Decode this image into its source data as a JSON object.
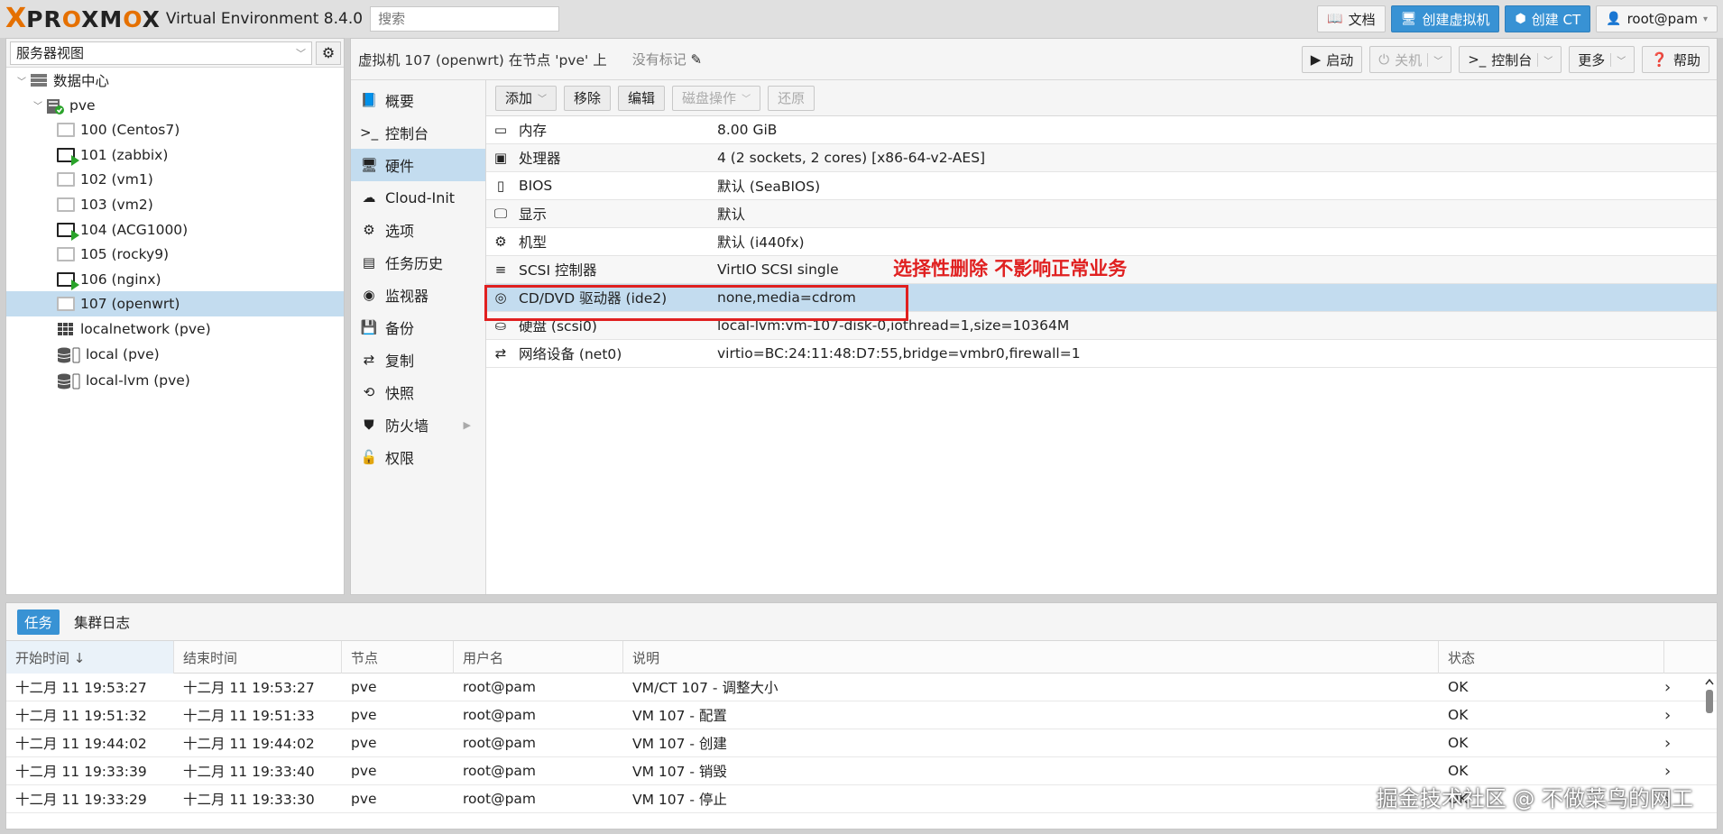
{
  "topbar": {
    "logo_x": "X",
    "logo_brand": "PROXMOX",
    "version": "Virtual Environment 8.4.0",
    "search_placeholder": "搜索",
    "buttons": {
      "docs": "文档",
      "create_vm": "创建虚拟机",
      "create_ct": "创建 CT",
      "user": "root@pam"
    }
  },
  "left": {
    "view": "服务器视图",
    "tree": [
      {
        "label": "数据中心",
        "type": "datacenter"
      },
      {
        "label": "pve",
        "type": "node"
      },
      {
        "label": "100 (Centos7)",
        "type": "vm",
        "running": false
      },
      {
        "label": "101 (zabbix)",
        "type": "vm",
        "running": true
      },
      {
        "label": "102 (vm1)",
        "type": "vm",
        "running": false
      },
      {
        "label": "103 (vm2)",
        "type": "vm",
        "running": false
      },
      {
        "label": "104 (ACG1000)",
        "type": "vm",
        "running": true
      },
      {
        "label": "105 (rocky9)",
        "type": "vm",
        "running": false
      },
      {
        "label": "106 (nginx)",
        "type": "vm",
        "running": true
      },
      {
        "label": "107 (openwrt)",
        "type": "vm",
        "running": false,
        "selected": true
      },
      {
        "label": "localnetwork (pve)",
        "type": "network"
      },
      {
        "label": "local (pve)",
        "type": "storage"
      },
      {
        "label": "local-lvm (pve)",
        "type": "storage"
      }
    ]
  },
  "main": {
    "title": "虚拟机 107 (openwrt) 在节点 'pve' 上",
    "tags": "没有标记",
    "buttons": {
      "start": "启动",
      "shutdown": "关机",
      "console": "控制台",
      "more": "更多",
      "help": "帮助"
    },
    "nav": [
      {
        "label": "概要",
        "icon": "summary-icon"
      },
      {
        "label": "控制台",
        "icon": "terminal-icon"
      },
      {
        "label": "硬件",
        "icon": "monitor-icon",
        "active": true
      },
      {
        "label": "Cloud-Init",
        "icon": "cloud-icon"
      },
      {
        "label": "选项",
        "icon": "gear-icon"
      },
      {
        "label": "任务历史",
        "icon": "list-icon"
      },
      {
        "label": "监视器",
        "icon": "eye-icon"
      },
      {
        "label": "备份",
        "icon": "floppy-icon"
      },
      {
        "label": "复制",
        "icon": "retweet-icon"
      },
      {
        "label": "快照",
        "icon": "history-icon"
      },
      {
        "label": "防火墙",
        "icon": "shield-icon"
      },
      {
        "label": "权限",
        "icon": "unlock-icon"
      }
    ],
    "hw_toolbar": {
      "add": "添加",
      "remove": "移除",
      "edit": "编辑",
      "disk_action": "磁盘操作",
      "revert": "还原"
    },
    "hardware": [
      {
        "name": "内存",
        "value": "8.00 GiB",
        "icon": "memory-icon"
      },
      {
        "name": "处理器",
        "value": "4 (2 sockets, 2 cores) [x86-64-v2-AES]",
        "icon": "cpu-icon"
      },
      {
        "name": "BIOS",
        "value": "默认 (SeaBIOS)",
        "icon": "microchip-icon"
      },
      {
        "name": "显示",
        "value": "默认",
        "icon": "desktop-icon"
      },
      {
        "name": "机型",
        "value": "默认 (i440fx)",
        "icon": "cogs-icon"
      },
      {
        "name": "SCSI 控制器",
        "value": "VirtIO SCSI single",
        "icon": "database-icon"
      },
      {
        "name": "CD/DVD 驱动器 (ide2)",
        "value": "none,media=cdrom",
        "icon": "cdrom-icon",
        "selected": true
      },
      {
        "name": "硬盘 (scsi0)",
        "value": "local-lvm:vm-107-disk-0,iothread=1,size=10364M",
        "icon": "hdd-icon"
      },
      {
        "name": "网络设备 (net0)",
        "value": "virtio=BC:24:11:48:D7:55,bridge=vmbr0,firewall=1",
        "icon": "exchange-icon"
      }
    ],
    "annotation": "选择性删除 不影响正常业务",
    "annotation_color": "#e02020"
  },
  "bottom": {
    "tabs": [
      "任务",
      "集群日志"
    ],
    "columns": [
      "开始时间 ↓",
      "结束时间",
      "节点",
      "用户名",
      "说明",
      "状态"
    ],
    "rows": [
      [
        "十二月 11 19:53:27",
        "十二月 11 19:53:27",
        "pve",
        "root@pam",
        "VM/CT 107 - 调整大小",
        "OK"
      ],
      [
        "十二月 11 19:51:32",
        "十二月 11 19:51:33",
        "pve",
        "root@pam",
        "VM 107 - 配置",
        "OK"
      ],
      [
        "十二月 11 19:44:02",
        "十二月 11 19:44:02",
        "pve",
        "root@pam",
        "VM 107 - 创建",
        "OK"
      ],
      [
        "十二月 11 19:33:39",
        "十二月 11 19:33:40",
        "pve",
        "root@pam",
        "VM 107 - 销毁",
        "OK"
      ],
      [
        "十二月 11 19:33:29",
        "十二月 11 19:33:30",
        "pve",
        "root@pam",
        "VM 107 - 停止",
        "OK"
      ]
    ]
  },
  "watermark": "掘金技术社区 @ 不做菜鸟的网工",
  "colors": {
    "accent": "#3892d4",
    "selected": "#c3dcef",
    "brand_orange": "#e57000",
    "running_green": "#2aa32a"
  }
}
